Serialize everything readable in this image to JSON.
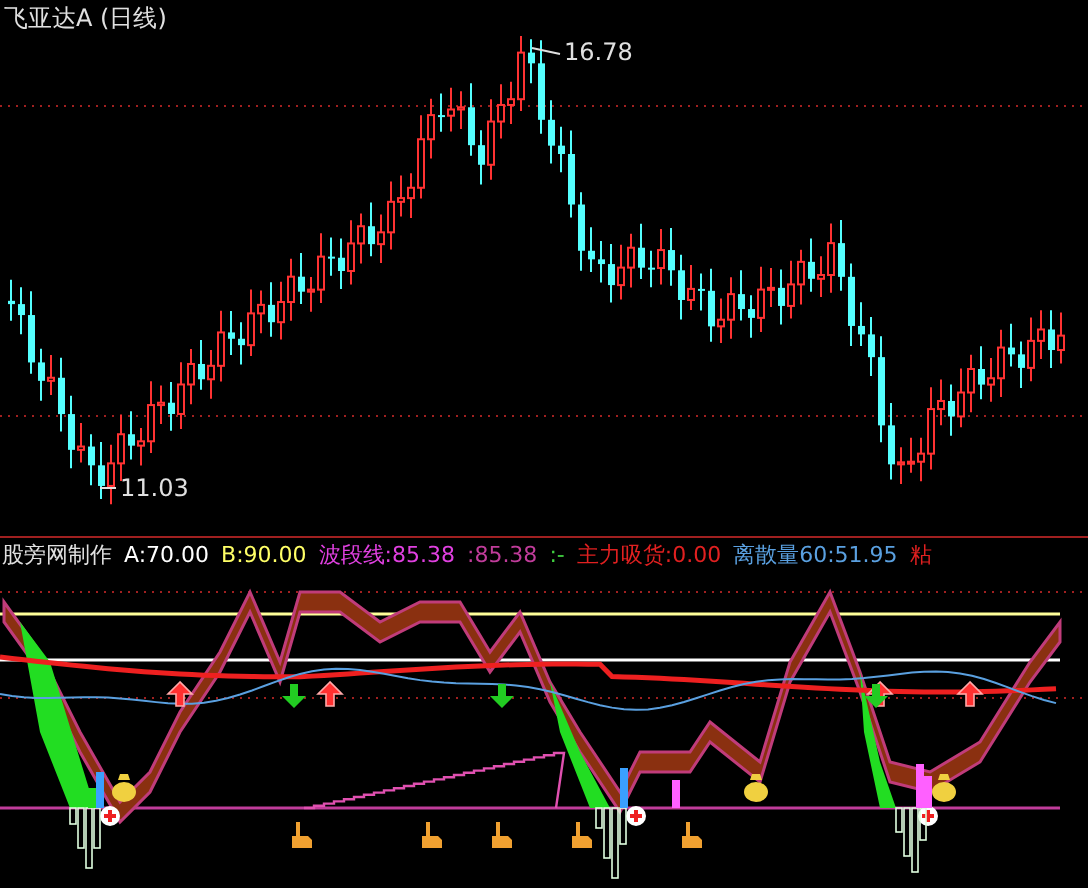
{
  "title": "飞亚达A (日线)",
  "price_chart": {
    "high_label": "16.78",
    "low_label": "11.03"
  },
  "indicator_legend": [
    {
      "text": "股旁网制作",
      "color": "#e0e0e0"
    },
    {
      "text": "A:70.00",
      "color": "#ffffff"
    },
    {
      "text": "B:90.00",
      "color": "#ffff66"
    },
    {
      "text": "波段线:85.38",
      "color": "#e040e0"
    },
    {
      "text": ":85.38",
      "color": "#c03c9a"
    },
    {
      "text": ":-",
      "color": "#40d040"
    },
    {
      "text": "主力吸货:0.00",
      "color": "#e02020"
    },
    {
      "text": "离散量60:51.95",
      "color": "#5aa0e0"
    },
    {
      "text": "粘",
      "color": "#e02020"
    }
  ]
}
